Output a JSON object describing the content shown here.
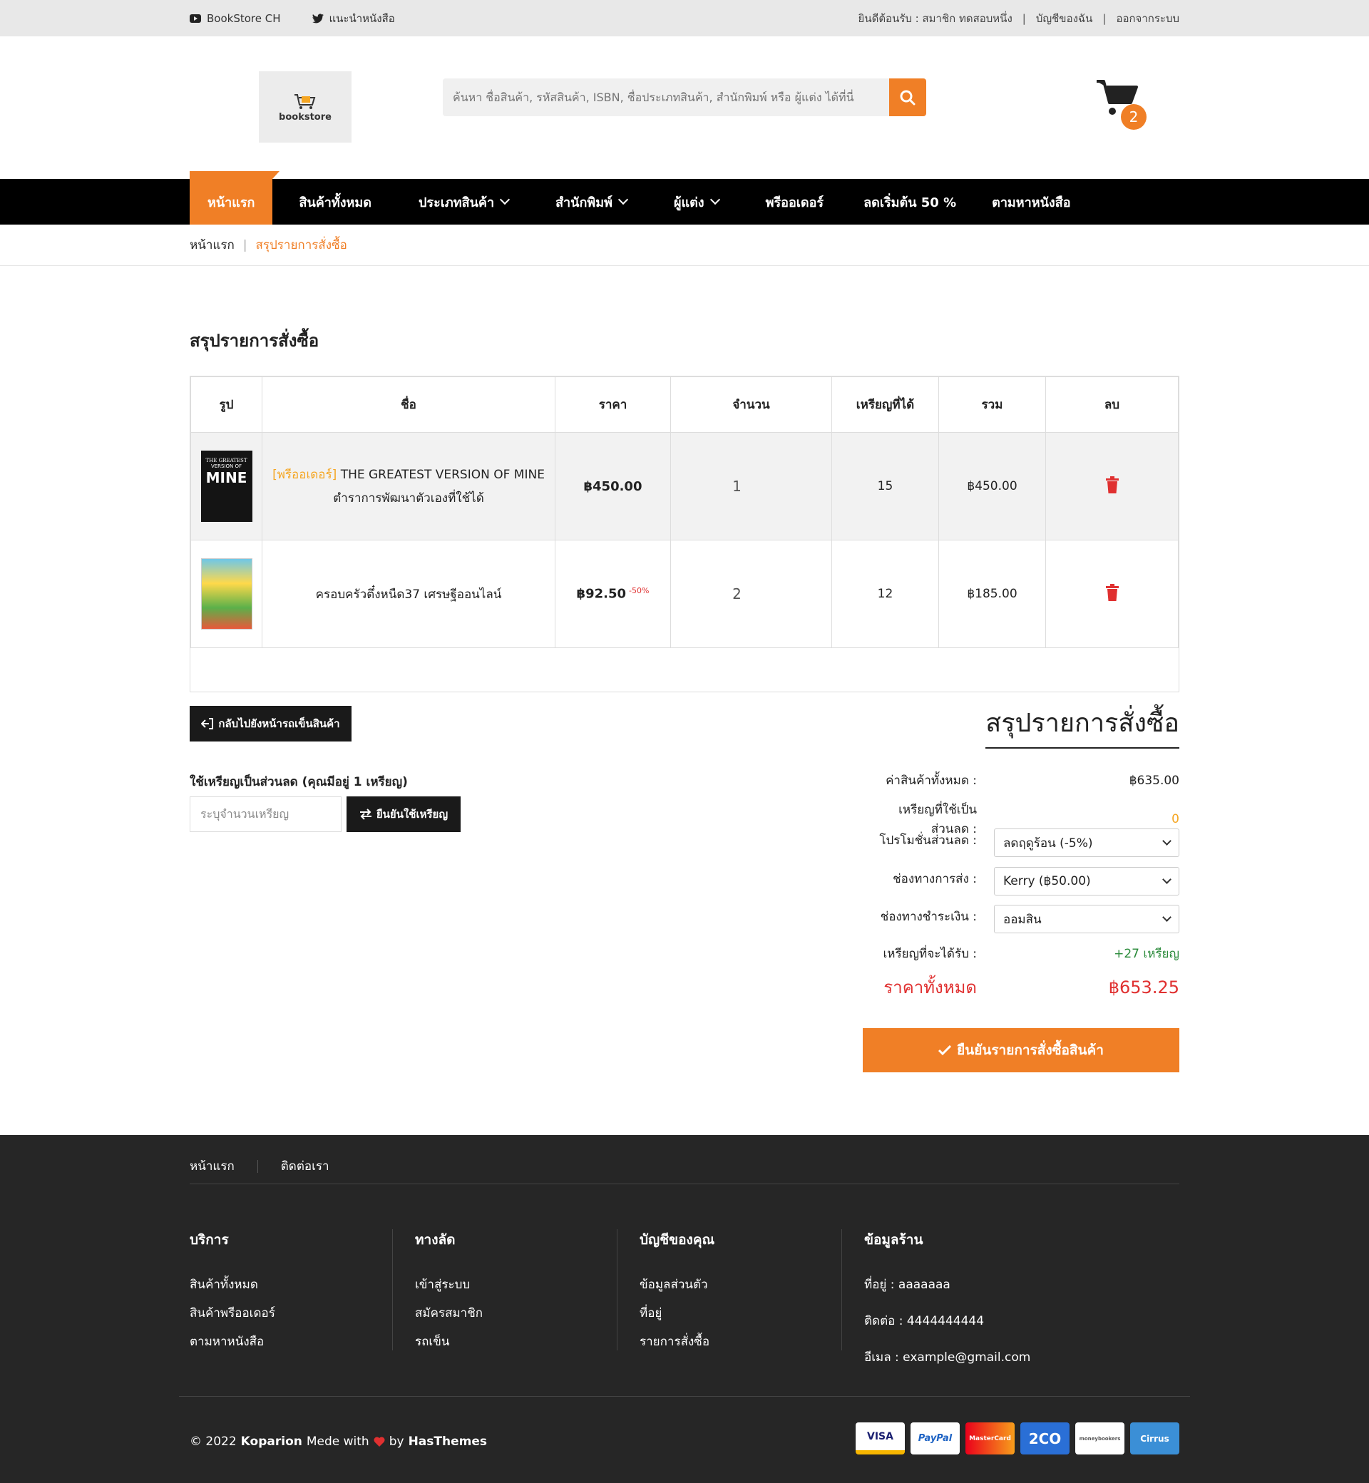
{
  "topbar": {
    "youtube_label": "BookStore CH",
    "twitter_label": "แนะนำหนังสือ",
    "welcome": "ยินดีต้อนรับ : สมาชิก ทดสอบหนึ่ง",
    "my_account": "บัญชีของฉัน",
    "logout": "ออกจากระบบ",
    "sep": "|"
  },
  "header": {
    "logo_text": "bookstore",
    "search_placeholder": "ค้นหา ชื่อสินค้า, รหัสสินค้า, ISBN, ชื่อประเภทสินค้า, สำนักพิมพ์ หรือ ผู้แต่ง ได้ที่นี่",
    "cart_count": "2"
  },
  "nav": [
    {
      "label": "หน้าแรก",
      "active": true
    },
    {
      "label": "สินค้าทั้งหมด"
    },
    {
      "label": "ประเภทสินค้า",
      "dropdown": true
    },
    {
      "label": "สำนักพิมพ์",
      "dropdown": true
    },
    {
      "label": "ผู้แต่ง",
      "dropdown": true
    },
    {
      "label": "พรีออเดอร์"
    },
    {
      "label": "ลดเริ่มต้น 50 %"
    },
    {
      "label": "ตามหาหนังสือ"
    }
  ],
  "breadcrumb": {
    "home": "หน้าแรก",
    "sep": "|",
    "current": "สรุปรายการสั่งซื้อ"
  },
  "page_title": "สรุปรายการสั่งซื้อ",
  "table": {
    "headers": [
      "รูป",
      "ชื่อ",
      "ราคา",
      "จำนวน",
      "เหรียญที่ได้",
      "รวม",
      "ลบ"
    ],
    "rows": [
      {
        "tag": "[พรีออเดอร์]",
        "name_line1": "THE GREATEST VERSION OF MINE",
        "name_line2": "ตำราการพัฒนาตัวเองที่ใช้ได้",
        "price": "฿450.00",
        "discount": "",
        "qty": "1",
        "coins": "15",
        "total": "฿450.00",
        "cover_title": "THE GREATEST",
        "cover_sub": "VERSION OF",
        "cover_big": "MINE"
      },
      {
        "tag": "",
        "name_line1": "ครอบครัวตึ๋งหนืด37 เศรษฐีออนไลน์",
        "name_line2": "",
        "price": "฿92.50",
        "discount": "-50%",
        "qty": "2",
        "coins": "12",
        "total": "฿185.00"
      }
    ]
  },
  "back_button": "กลับไปยังหน้ารถเข็นสินค้า",
  "coins": {
    "label": "ใช้เหรียญเป็นส่วนลด (คุณมีอยู่ 1 เหรียญ)",
    "placeholder": "ระบุจำนวนเหรียญ",
    "button": "ยืนยันใช้เหรียญ"
  },
  "summary": {
    "title": "สรุปรายการสั่งซื้อ",
    "subtotal_label": "ค่าสินค้าทั้งหมด :",
    "subtotal": "฿635.00",
    "coins_used_label": "เหรียญที่ใช้เป็นส่วนลด :",
    "coins_used": "0",
    "promo_label": "โปรโมชั่นส่วนลด :",
    "promo": "ลดฤดูร้อน (-5%)",
    "shipping_label": "ช่องทางการส่ง :",
    "shipping": "Kerry (฿50.00)",
    "payment_label": "ช่องทางชำระเงิน :",
    "payment": "ออมสิน",
    "coins_earn_label": "เหรียญที่จะได้รับ :",
    "coins_earn": "+27 เหรียญ",
    "total_label": "ราคาทั้งหมด",
    "total": "฿653.25",
    "confirm": "ยืนยันรายการสั่งซื้อสินค้า"
  },
  "footer": {
    "links": [
      "หน้าแรก",
      "ติดต่อเรา"
    ],
    "cols": [
      {
        "title": "บริการ",
        "items": [
          "สินค้าทั้งหมด",
          "สินค้าพรีออเดอร์",
          "ตามหาหนังสือ"
        ]
      },
      {
        "title": "ทางลัด",
        "items": [
          "เข้าสู่ระบบ",
          "สมัครสมาชิก",
          "รถเข็น"
        ]
      },
      {
        "title": "บัญชีของคุณ",
        "items": [
          "ข้อมูลส่วนตัว",
          "ที่อยู่",
          "รายการสั่งซื้อ"
        ]
      },
      {
        "title": "ข้อมูลร้าน",
        "items": [
          "ที่อยู่ : aaaaaaa",
          "ติดต่อ : 4444444444",
          "อีเมล : example@gmail.com"
        ]
      }
    ],
    "copy_prefix": "© 2022",
    "copy_brand": "Koparion",
    "copy_mid": "Mede with",
    "copy_by": "by",
    "copy_author": "HasThemes",
    "payments": [
      "VISA",
      "PayPal",
      "MasterCard",
      "2CO",
      "moneybookers",
      "Cirrus"
    ]
  },
  "colors": {
    "accent": "#f07f26",
    "dark": "#262626",
    "danger": "#e03030"
  }
}
